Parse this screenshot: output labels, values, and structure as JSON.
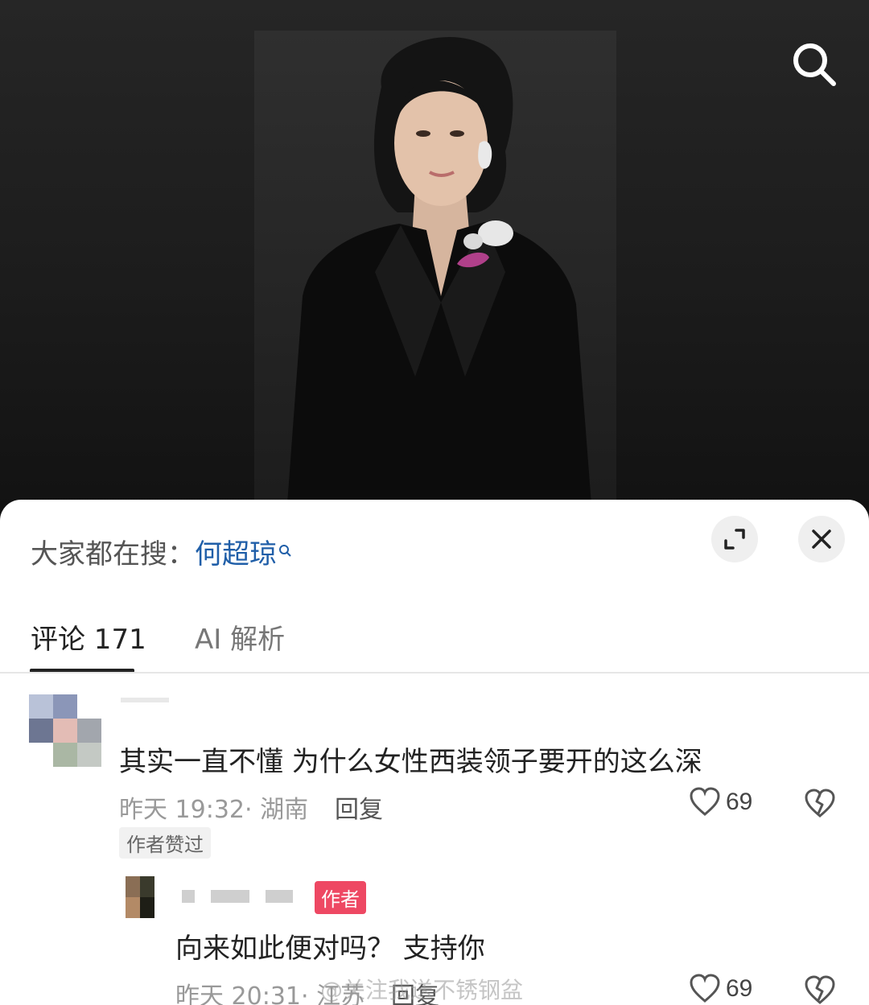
{
  "hot_search": {
    "prefix": "大家都在搜：",
    "keyword": "何超琼"
  },
  "tabs": [
    {
      "label": "评论 171"
    },
    {
      "label": "AI 解析"
    }
  ],
  "comments": [
    {
      "text": "其实一直不懂 为什么女性西装领子要开的这么深",
      "time_location": "昨天 19:32· 湖南",
      "reply_label": "回复",
      "likes": "69",
      "badge": "作者赞过"
    },
    {
      "author_badge": "作者",
      "text": "向来如此便对吗？ 支持你",
      "time_location": "昨天 20:31· 江苏",
      "reply_label": "回复",
      "likes": "69"
    }
  ],
  "watermark": "@关注我送不锈钢盆",
  "colors": {
    "accent_link": "#1f5ea8",
    "author_badge": "#ee4863",
    "top_background": "#1c1c1c"
  },
  "icons": [
    "search-icon",
    "expand-icon",
    "close-icon",
    "heart-icon",
    "broken-heart-icon"
  ]
}
